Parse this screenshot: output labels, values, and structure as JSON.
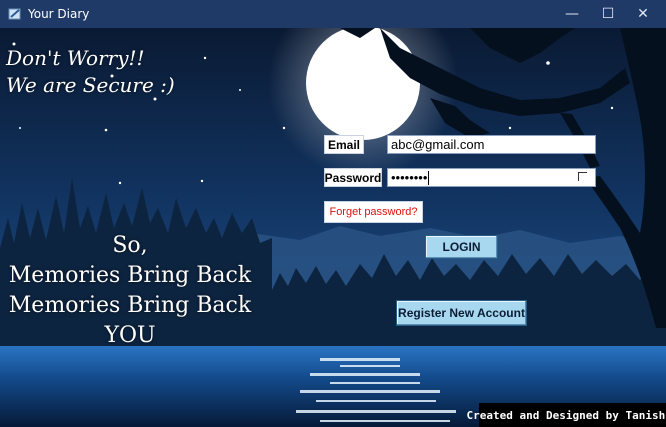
{
  "window": {
    "title": "Your Diary",
    "minimize_glyph": "—",
    "maximize_glyph": "☐",
    "close_glyph": "✕",
    "app_icon": "diary-app-icon"
  },
  "scene": {
    "tagline_line1": "Don't Worry!!",
    "tagline_line2": "We are Secure :)",
    "memories_line1": "So,",
    "memories_line2": "Memories Bring Back",
    "memories_line3": "Memories Bring Back",
    "memories_line4": "YOU"
  },
  "login_form": {
    "email_label": "Email",
    "email_value": "abc@gmail.com",
    "password_label": "Password",
    "password_masked": "••••••••",
    "forgot_password_label": "Forget password?",
    "login_label": "LOGIN",
    "register_label": "Register New Account"
  },
  "footer": {
    "credit": "Created and Designed by Tanishka"
  },
  "colors": {
    "titlebar": "#1f3a67",
    "sky_top": "#0a1a33",
    "sky_bottom": "#1f4f86",
    "moon": "#ffffff",
    "button": "#a8d8f0",
    "forgot_text": "#dd1111"
  }
}
